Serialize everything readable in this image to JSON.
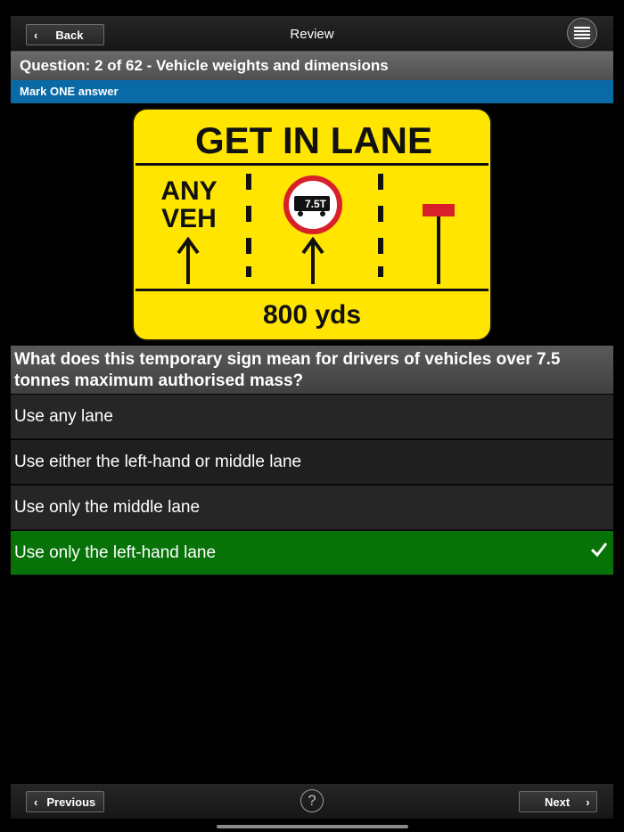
{
  "topbar": {
    "back_label": "Back",
    "title": "Review",
    "menu_icon": "hamburger-menu-icon"
  },
  "question_header": {
    "text": "Question: 2 of 62 - Vehicle weights and dimensions"
  },
  "instruction": "Mark ONE answer",
  "sign": {
    "heading": "GET IN LANE",
    "left_lane_text_line1": "ANY",
    "left_lane_text_line2": "VEH",
    "weight_limit": "7.5T",
    "distance": "800 yds",
    "colors": {
      "background": "#ffe500",
      "border": "#111111",
      "ring": "#d8202a",
      "bar": "#d8202a"
    }
  },
  "question": {
    "text": "What does this temporary sign mean for drivers of vehicles over 7.5 tonnes maximum authorised mass?"
  },
  "answers": [
    {
      "label": "Use any lane",
      "state": "normal"
    },
    {
      "label": "Use either the left-hand or middle lane",
      "state": "normal"
    },
    {
      "label": "Use only the middle lane",
      "state": "normal"
    },
    {
      "label": "Use only the left-hand lane",
      "state": "correct"
    }
  ],
  "bottombar": {
    "previous_label": "Previous",
    "help_label": "?",
    "next_label": "Next"
  },
  "colors": {
    "correct_green": "#077207",
    "instruction_blue": "#0a6aa6"
  }
}
